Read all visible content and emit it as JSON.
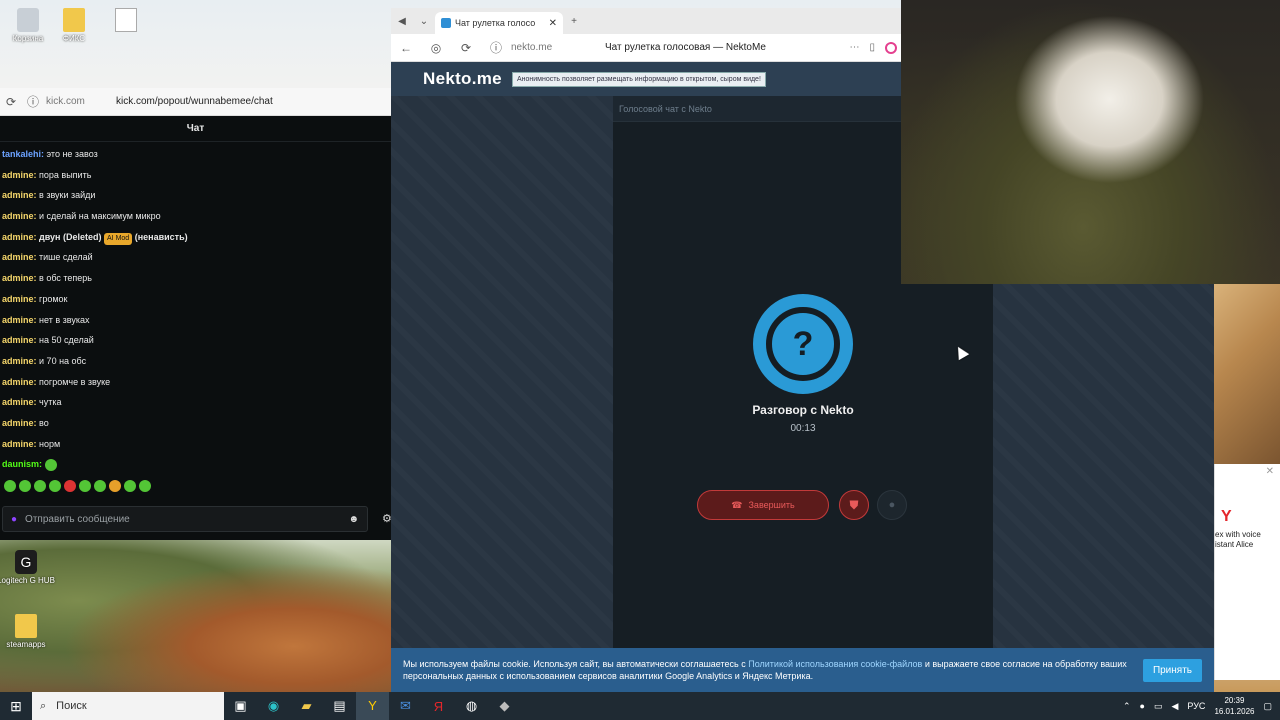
{
  "desktop": {
    "icons": [
      {
        "label": "Корзина"
      },
      {
        "label": "ФИКС"
      },
      {
        "label": ""
      },
      {
        "label": "Logitech G HUB"
      },
      {
        "label": "steamapps"
      }
    ]
  },
  "kick_window": {
    "domain": "kick.com",
    "url": "kick.com/popout/wunnabemee/chat",
    "title": "Чат",
    "messages": [
      {
        "user": "tankalehi:",
        "text": "это не завоз",
        "color": "blue"
      },
      {
        "user": "admine:",
        "text": "пора выпить"
      },
      {
        "user": "admine:",
        "text": "в звуки зайди"
      },
      {
        "user": "admine:",
        "text": "и сделай на максимум микро"
      },
      {
        "user": "admine:",
        "text": "двун (Deleted)",
        "badge": "AI Mod",
        "after": "(ненависть)"
      },
      {
        "user": "admine:",
        "text": "тише сделай"
      },
      {
        "user": "admine:",
        "text": "в обс теперь"
      },
      {
        "user": "admine:",
        "text": "громок"
      },
      {
        "user": "admine:",
        "text": "нет в звуках"
      },
      {
        "user": "admine:",
        "text": "на 50 сделай"
      },
      {
        "user": "admine:",
        "text": "и 70 на обс"
      },
      {
        "user": "admine:",
        "text": "погромче в звуке"
      },
      {
        "user": "admine:",
        "text": "чутка"
      },
      {
        "user": "admine:",
        "text": "во"
      },
      {
        "user": "admine:",
        "text": "норм"
      },
      {
        "user": "daunism:",
        "text": "",
        "color": "green"
      }
    ],
    "input_placeholder": "Отправить сообщение"
  },
  "browser": {
    "tab_title": "Чат рулетка голосо",
    "domain": "nekto.me",
    "page_title": "Чат рулетка голосовая — NektoMe",
    "logo": "Nekto.me",
    "notice": "Анонимность позволяет размещать информацию в открытом, сыром виде!",
    "panel_title": "Голосовой чат с Nekto",
    "avatar_glyph": "?",
    "partner_name": "Разговор с Nekto",
    "timer": "00:13",
    "end_button": "Завершить",
    "cookie": {
      "text_before": "Мы используем файлы cookie. Используя сайт, вы автоматически соглашаетесь с ",
      "link": "Политикой использования cookie-файлов",
      "text_after": " и выражаете свое согласие на обработку ваших персональных данных с использованием сервисов аналитики Google Analytics и Яндекс Метрика.",
      "button": "Принять"
    }
  },
  "yandex_widget": {
    "letter": "Y",
    "text": "ex with voice istant Alice"
  },
  "taskbar": {
    "search_label": "Поиск",
    "lang": "РУС",
    "time": "20:39",
    "date": "16.01.2026"
  }
}
